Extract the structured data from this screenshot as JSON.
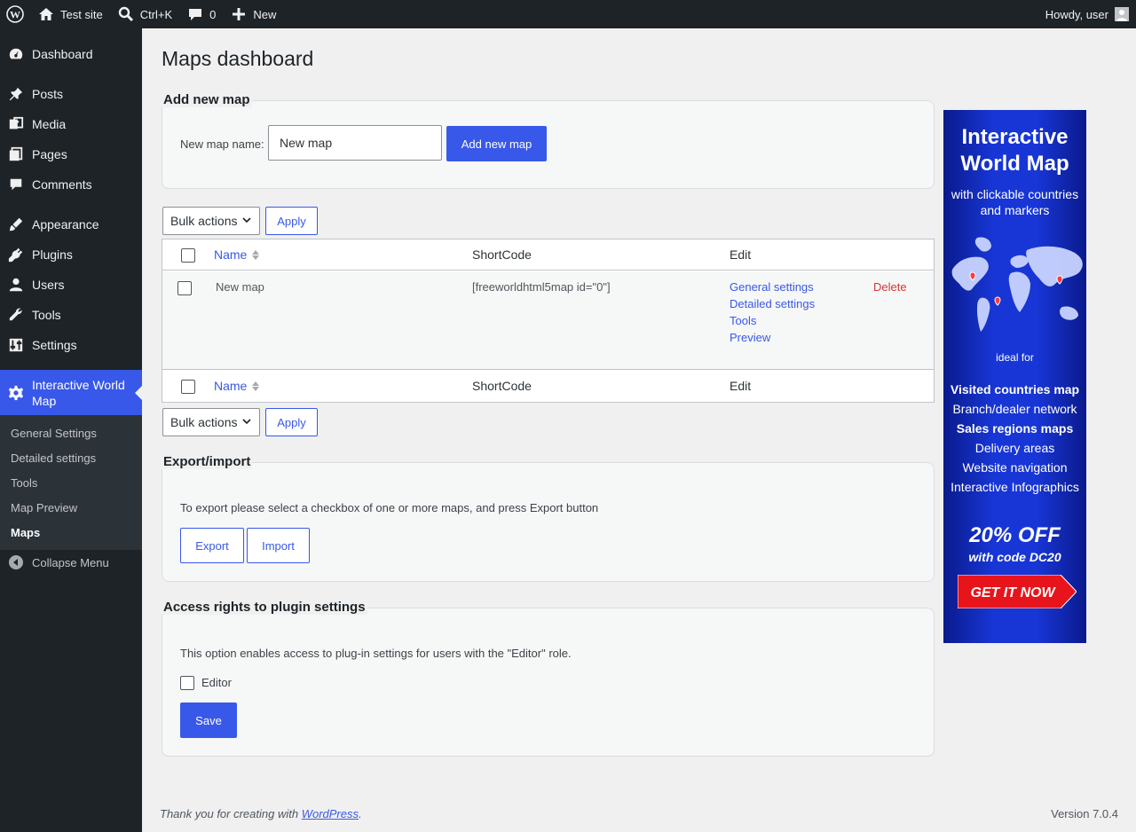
{
  "adminbar": {
    "site_name": "Test site",
    "search_shortcut": "Ctrl+K",
    "comments_count": "0",
    "new_label": "New",
    "greeting": "Howdy, user"
  },
  "sidebar": {
    "items": [
      {
        "label": "Dashboard",
        "icon": "dashboard-icon"
      },
      {
        "label": "Posts",
        "icon": "pin-icon"
      },
      {
        "label": "Media",
        "icon": "media-icon"
      },
      {
        "label": "Pages",
        "icon": "pages-icon"
      },
      {
        "label": "Comments",
        "icon": "comment-icon"
      },
      {
        "label": "Appearance",
        "icon": "brush-icon"
      },
      {
        "label": "Plugins",
        "icon": "plugin-icon"
      },
      {
        "label": "Users",
        "icon": "user-icon"
      },
      {
        "label": "Tools",
        "icon": "wrench-icon"
      },
      {
        "label": "Settings",
        "icon": "settings-icon"
      },
      {
        "label": "Interactive World Map",
        "icon": "gear-icon"
      }
    ],
    "submenu": [
      "General Settings",
      "Detailed settings",
      "Tools",
      "Map Preview",
      "Maps"
    ],
    "collapse_label": "Collapse Menu"
  },
  "page": {
    "title": "Maps dashboard",
    "add_map": {
      "legend": "Add new map",
      "label": "New map name:",
      "input_value": "New map",
      "button": "Add new map"
    },
    "bulk": {
      "select_value": "Bulk actions",
      "apply": "Apply"
    },
    "table": {
      "columns": [
        "Name",
        "ShortCode",
        "Edit"
      ],
      "rows": [
        {
          "name": "New map",
          "shortcode": "[freeworldhtml5map id=\"0\"]",
          "edit_links": [
            "General settings",
            "Detailed settings",
            "Tools",
            "Preview"
          ],
          "delete": "Delete"
        }
      ]
    },
    "export": {
      "legend": "Export/import",
      "text": "To export please select a checkbox of one or more maps, and press Export button",
      "export_button": "Export",
      "import_button": "Import"
    },
    "access": {
      "legend": "Access rights to plugin settings",
      "text": "This option enables access to plug-in settings for users with the \"Editor\" role.",
      "checkbox_label": "Editor",
      "save_button": "Save"
    }
  },
  "banner": {
    "title_line1": "Interactive",
    "title_line2": "World Map",
    "subtitle_line1": "with clickable countries",
    "subtitle_line2": "and markers",
    "ideal": "ideal for",
    "uses": [
      "Visited countries map",
      "Branch/dealer network",
      "Sales regions maps",
      "Delivery areas",
      "Website navigation",
      "Interactive Infographics"
    ],
    "discount": "20% OFF",
    "code": "with code DC20",
    "cta": "GET IT NOW"
  },
  "footer": {
    "thanks_prefix": "Thank you for creating with ",
    "thanks_link": "WordPress",
    "thanks_suffix": ".",
    "version": "Version 7.0.4"
  },
  "colors": {
    "accent": "#3858e9",
    "sidebar_bg": "#1d2327",
    "delete": "#d63638"
  }
}
